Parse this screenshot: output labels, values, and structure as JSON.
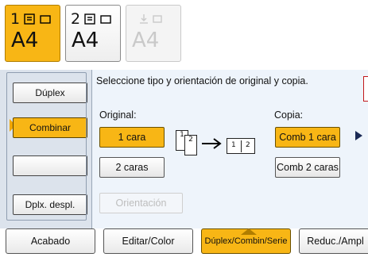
{
  "trays": [
    {
      "number": "1",
      "size": "A4",
      "state": "selected"
    },
    {
      "number": "2",
      "size": "A4",
      "state": "normal"
    },
    {
      "number": "",
      "size": "A4",
      "state": "disabled"
    }
  ],
  "sidebar": {
    "items": [
      {
        "label": "Dúplex"
      },
      {
        "label": "Combinar"
      },
      {
        "label": ""
      },
      {
        "label": "Dplx. despl."
      }
    ]
  },
  "content": {
    "instruction": "Seleccione tipo y orientación de original y copia.",
    "original": {
      "label": "Original:",
      "options": [
        "1 cara",
        "2 caras"
      ],
      "selected": "1 cara"
    },
    "copy": {
      "label": "Copia:",
      "options": [
        "Comb 1 cara",
        "Comb 2 caras"
      ],
      "selected": "Comb 1 cara"
    },
    "orientation_label": "Orientación",
    "diagram": {
      "original_pages": [
        "1",
        "2"
      ],
      "copy_pages": [
        "1",
        "2"
      ]
    }
  },
  "tabs": [
    {
      "label": "Acabado"
    },
    {
      "label": "Editar/Color"
    },
    {
      "label": "Dúplex/Combin/Serie"
    },
    {
      "label": "Reduc./Ampl"
    }
  ],
  "colors": {
    "accent": "#f8b615",
    "panel": "#eef4fb",
    "sidebar": "#dce3ec"
  }
}
